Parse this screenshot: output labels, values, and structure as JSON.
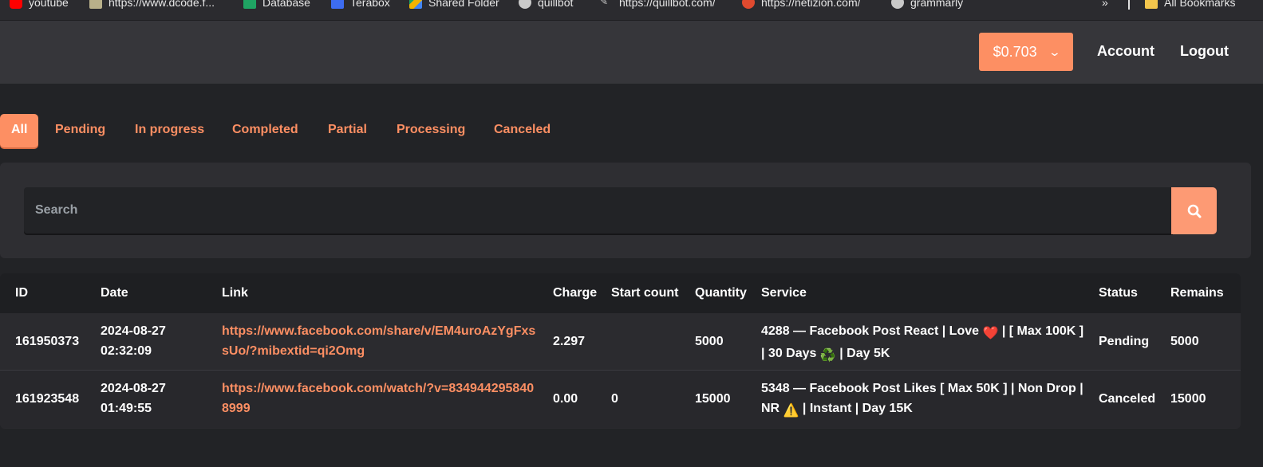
{
  "bookmarks": [
    {
      "label": "youtube",
      "icon": "youtube-icon",
      "color": "#ff0000"
    },
    {
      "label": "https://www.dcode.f...",
      "icon": "dcode-icon",
      "color": "#b8b08a"
    },
    {
      "label": "Database",
      "icon": "sheets-icon",
      "color": "#1fa463"
    },
    {
      "label": "Terabox",
      "icon": "terabox-icon",
      "color": "#3d6cf0"
    },
    {
      "label": "Shared Folder",
      "icon": "drive-icon",
      "color": "#f4b400"
    },
    {
      "label": "quillbot",
      "icon": "quillbot-icon",
      "color": "#c9c9c9"
    },
    {
      "label": "https://quillbot.com/",
      "icon": "link-icon",
      "color": "#c9c9c9"
    },
    {
      "label": "https://netizion.com/",
      "icon": "netizion-icon",
      "color": "#e04a2f"
    },
    {
      "label": "grammarly",
      "icon": "grammarly-icon",
      "color": "#c9c9c9"
    },
    {
      "label": "All Bookmarks",
      "icon": "folder-icon",
      "color": "#f3c64d"
    }
  ],
  "overflow_label": "»",
  "header": {
    "balance": "$0.703",
    "account": "Account",
    "logout": "Logout"
  },
  "tabs": [
    "All",
    "Pending",
    "In progress",
    "Completed",
    "Partial",
    "Processing",
    "Canceled"
  ],
  "search": {
    "placeholder": "Search"
  },
  "table": {
    "columns": [
      "ID",
      "Date",
      "Link",
      "Charge",
      "Start count",
      "Quantity",
      "Service",
      "Status",
      "Remains"
    ],
    "rows": [
      {
        "id": "161950373",
        "date": "2024-08-27",
        "time": "02:32:09",
        "link": "https://www.facebook.com/share/v/EM4uroAzYgFxssUo/?mibextid=qi2Omg",
        "charge": "2.297",
        "start_count": "",
        "quantity": "5000",
        "service_a": "4288 — Facebook Post React | Love ",
        "service_emoji1": "❤️",
        "service_b": " | [ Max 100K ] | 30 Days ",
        "service_emoji2": "♻️",
        "service_c": " | Day 5K",
        "status": "Pending",
        "remains": "5000"
      },
      {
        "id": "161923548",
        "date": "2024-08-27",
        "time": "01:49:55",
        "link": "https://www.facebook.com/watch/?v=8349442958408999",
        "charge": "0.00",
        "start_count": "0",
        "quantity": "15000",
        "service_a": "5348 — Facebook Post Likes [ Max 50K ] | Non Drop | NR ",
        "service_emoji1": "⚠️",
        "service_b": " | Instant | Day 15K",
        "status": "Canceled",
        "remains": "15000"
      }
    ]
  },
  "colors": {
    "accent": "#fd8f63",
    "background": "#222326",
    "panel": "#2e2e32"
  }
}
